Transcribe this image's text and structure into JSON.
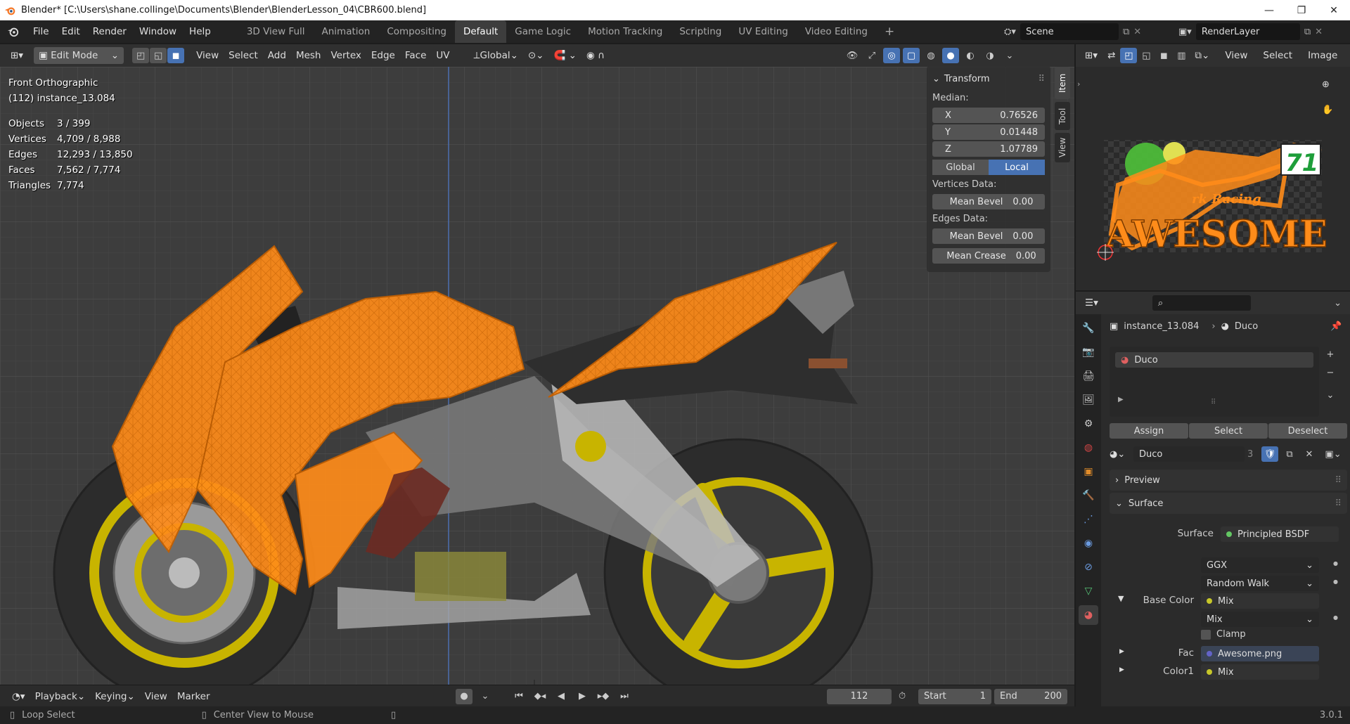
{
  "window": {
    "title": "Blender* [C:\\Users\\shane.collinge\\Documents\\Blender\\BlenderLesson_04\\CBR600.blend]",
    "controls": [
      "—",
      "❐",
      "✕"
    ]
  },
  "menus": [
    "File",
    "Edit",
    "Render",
    "Window",
    "Help"
  ],
  "workspaces": [
    "3D View Full",
    "Animation",
    "Compositing",
    "Default",
    "Game Logic",
    "Motion Tracking",
    "Scripting",
    "UV Editing",
    "Video Editing"
  ],
  "active_workspace": "Default",
  "add_workspace": "+",
  "scene": {
    "name": "Scene",
    "render_layer": "RenderLayer"
  },
  "viewport": {
    "mode": "Edit Mode",
    "menus": [
      "View",
      "Select",
      "Add",
      "Mesh",
      "Vertex",
      "Edge",
      "Face",
      "UV"
    ],
    "orientation": "Global",
    "view_name": "Front Orthographic",
    "object_name": "(112) instance_13.084",
    "stats": [
      {
        "k": "Objects",
        "v": "3 / 399"
      },
      {
        "k": "Vertices",
        "v": "4,709 / 8,988"
      },
      {
        "k": "Edges",
        "v": "12,293 / 13,850"
      },
      {
        "k": "Faces",
        "v": "7,562 / 7,774"
      },
      {
        "k": "Triangles",
        "v": "7,774"
      }
    ]
  },
  "npanel": {
    "title": "Transform",
    "median_label": "Median:",
    "x": {
      "label": "X",
      "value": "0.76526"
    },
    "y": {
      "label": "Y",
      "value": "0.01448"
    },
    "z": {
      "label": "Z",
      "value": "1.07789"
    },
    "global": "Global",
    "local": "Local",
    "vertices_data": "Vertices Data:",
    "vert_mean_bevel": {
      "label": "Mean Bevel",
      "value": "0.00"
    },
    "edges_data": "Edges Data:",
    "edge_mean_bevel": {
      "label": "Mean Bevel",
      "value": "0.00"
    },
    "edge_mean_crease": {
      "label": "Mean Crease",
      "value": "0.00"
    },
    "tabs": [
      "Item",
      "Tool",
      "View"
    ]
  },
  "timeline": {
    "menus": [
      "Playback",
      "Keying",
      "View",
      "Marker"
    ],
    "current_frame": "112",
    "start_label": "Start",
    "start": "1",
    "end_label": "End",
    "end": "200"
  },
  "image_editor": {
    "menus": [
      "View",
      "Select",
      "Image"
    ],
    "texture": {
      "top_text": "rk Racing",
      "big_text": "AWESOME",
      "badge": "71"
    }
  },
  "properties": {
    "breadcrumb_object": "instance_13.084",
    "breadcrumb_material": "Duco",
    "slot_name": "Duco",
    "assign": "Assign",
    "select": "Select",
    "deselect": "Deselect",
    "material_name": "Duco",
    "users": "3",
    "preview": "Preview",
    "surface_panel": "Surface",
    "surface_label": "Surface",
    "surface_value": "Principled BSDF",
    "distribution": "GGX",
    "subsurface_method": "Random Walk",
    "base_color_label": "Base Color",
    "base_color_value": "Mix",
    "mix_mode": "Mix",
    "clamp": "Clamp",
    "fac_label": "Fac",
    "fac_value": "Awesome.png",
    "color1_label": "Color1",
    "color1_value": "Mix"
  },
  "status": {
    "left": "Loop Select",
    "middle": "Center View to Mouse",
    "version": "3.0.1"
  },
  "colors": {
    "accent": "#4772b3",
    "mesh_orange": "#ff8c1a",
    "wheel_yellow": "#c8b400",
    "socket_yellow": "#c7c729",
    "socket_green": "#63c763",
    "socket_blue": "#6363c7"
  }
}
